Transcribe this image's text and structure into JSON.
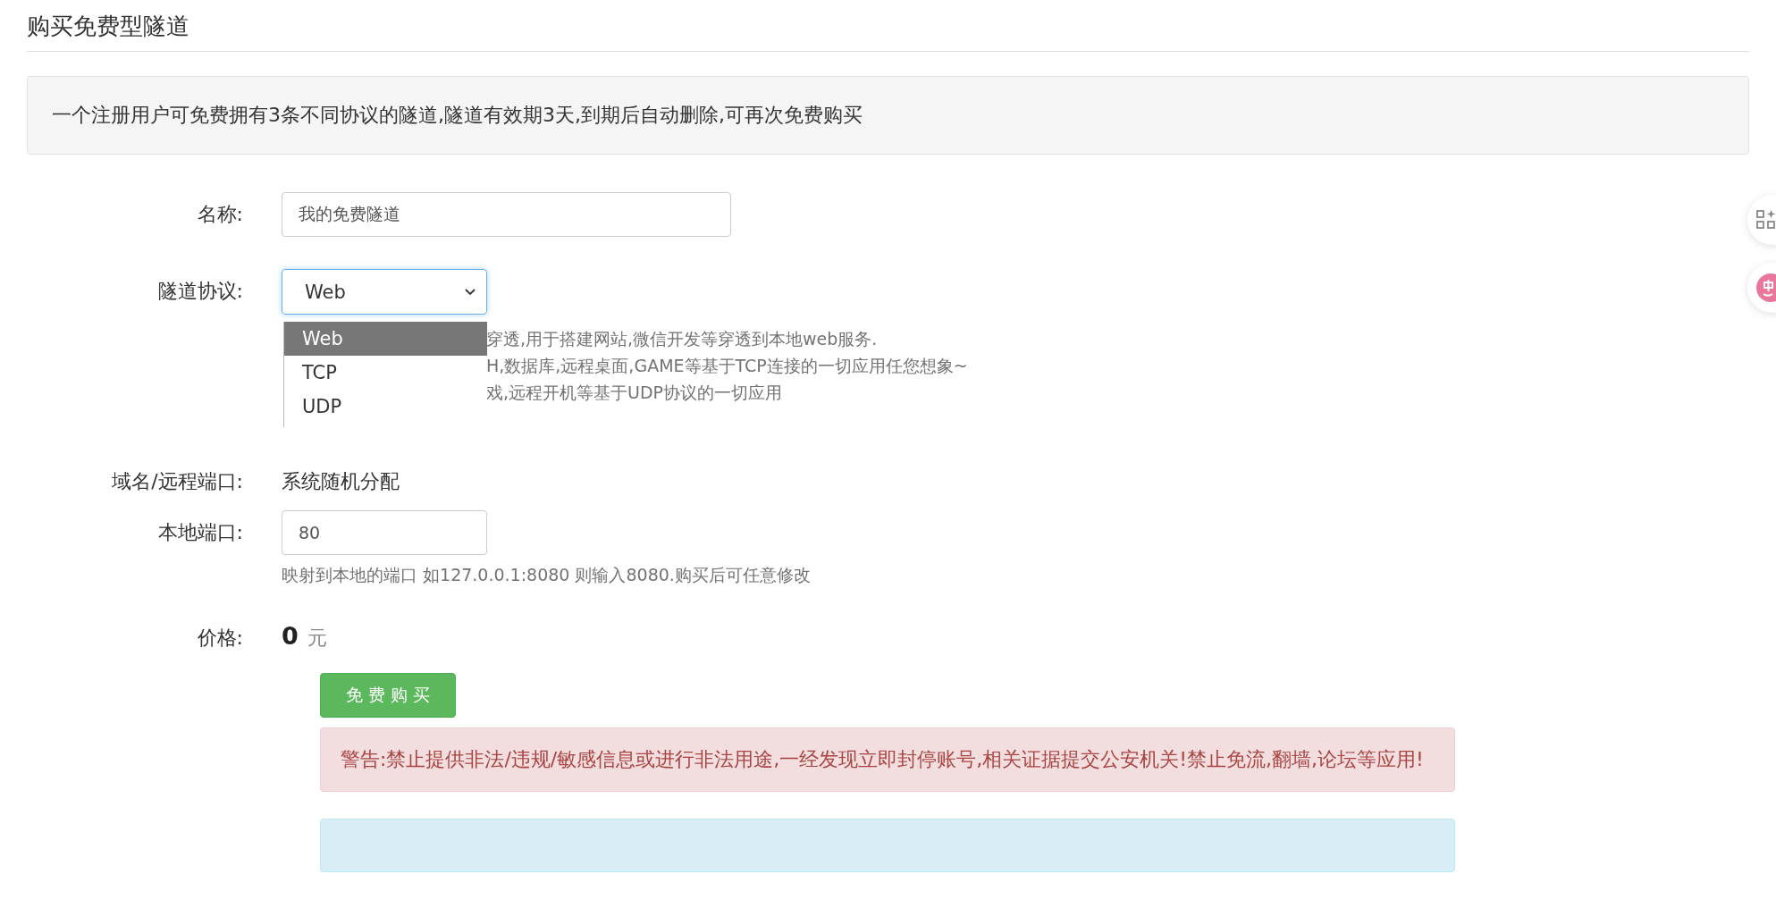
{
  "page_title": "购买免费型隧道",
  "notice": "一个注册用户可免费拥有3条不同协议的隧道,隧道有效期3天,到期后自动删除,可再次免费购买",
  "form": {
    "name": {
      "label": "名称:",
      "value": "我的免费隧道"
    },
    "protocol": {
      "label": "隧道协议:",
      "value": "Web",
      "options": [
        {
          "label": "Web",
          "selected": true
        },
        {
          "label": "TCP",
          "selected": false
        },
        {
          "label": "UDP",
          "selected": false
        }
      ],
      "help": [
        "穿透,用于搭建网站,微信开发等穿透到本地web服务.",
        "H,数据库,远程桌面,GAME等基于TCP连接的一切应用任您想象~",
        "戏,远程开机等基于UDP协议的一切应用"
      ]
    },
    "remote": {
      "label": "域名/远程端口:",
      "value": "系统随机分配"
    },
    "local_port": {
      "label": "本地端口:",
      "value": "80",
      "help": "映射到本地的端口 如127.0.0.1:8080 则输入8080.购买后可任意修改"
    },
    "price": {
      "label": "价格:",
      "amount": "0",
      "unit": "元"
    }
  },
  "submit_button": "免 费 购 买",
  "warning": "警告:禁止提供非法/违规/敏感信息或进行非法用途,一经发现立即封停账号,相关证据提交公安机关!禁止免流,翻墙,论坛等应用!"
}
